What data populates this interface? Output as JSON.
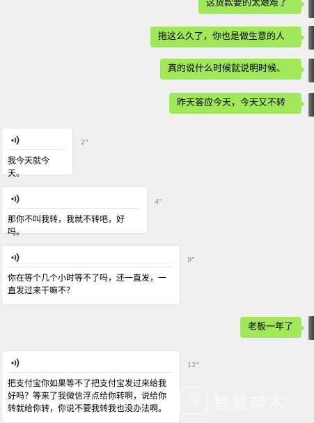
{
  "outgoing": [
    {
      "text": "这货款要的太艰难了"
    },
    {
      "text": "拖这么久了，你也是做生意的人"
    },
    {
      "text": "真的说什么时候就说明时候、"
    },
    {
      "text": "昨天答应今天，今天又不转"
    },
    {
      "text": "老板一年了"
    }
  ],
  "voice_messages": [
    {
      "duration": "2\"",
      "transcript": "我今天就今天。"
    },
    {
      "duration": "4\"",
      "transcript": "那你不叫我转，我就不转吧，好吗。"
    },
    {
      "duration": "9\"",
      "transcript": "你在等个几个小时等不了吗，还一直发，一直发过来干嘛不？"
    },
    {
      "duration": "12\"",
      "transcript": "把支付宝你如果等不了把支付宝发过来给我好吗？等来了我微信浮点给你转啊，说给你转就给你转，你说不要我转我也没办法啊。"
    }
  ],
  "watermark": {
    "logo_line1": "智慧",
    "logo_line2": "神木",
    "text": "智慧神木"
  },
  "colors": {
    "background": "#f0f0f0",
    "outgoing_bubble": "#a0e75a",
    "incoming_bubble": "#ffffff"
  }
}
